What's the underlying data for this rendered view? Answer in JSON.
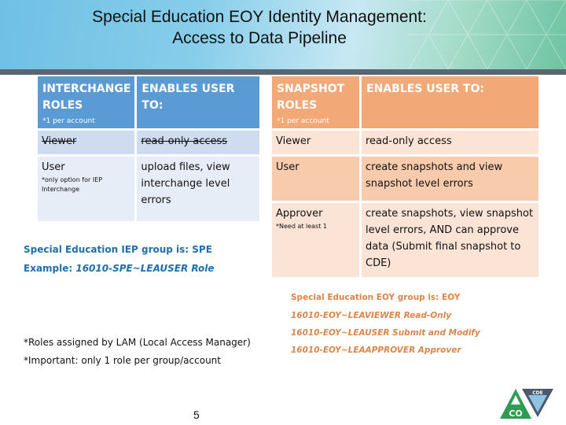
{
  "header": {
    "title_line1": "Special Education EOY Identity Management:",
    "title_line2": "Access to Data Pipeline"
  },
  "interchange_table": {
    "headers": {
      "role": "INTERCHANGE ROLES",
      "role_note": "*1 per account",
      "enables": "ENABLES USER TO:"
    },
    "rows": [
      {
        "role": "Viewer",
        "note": "",
        "enables": "read-only access",
        "struck": true
      },
      {
        "role": "User",
        "note": "*only option for IEP Interchange",
        "enables": "upload files, view interchange level errors",
        "struck": false
      }
    ],
    "color": "#5b9bd5"
  },
  "snapshot_table": {
    "headers": {
      "role": "SNAPSHOT ROLES",
      "role_note": "*1 per account",
      "enables": "ENABLES USER TO:"
    },
    "rows": [
      {
        "role": "Viewer",
        "note": "",
        "enables": "read-only access"
      },
      {
        "role": "User",
        "note": "",
        "enables": "create snapshots and view snapshot level errors"
      },
      {
        "role": "Approver",
        "note": "*Need at least 1",
        "enables": "create snapshots, view snapshot level errors, AND can approve data (Submit final snapshot to CDE)"
      }
    ],
    "color": "#f2a977"
  },
  "iep_notes": {
    "group": "Special Education IEP group is: SPE",
    "example_label": "Example: ",
    "example_value": "16010-SPE~LEAUSER Role"
  },
  "eoy_notes": {
    "group": "Special Education EOY group is: EOY",
    "roles": [
      "16010-EOY~LEAVIEWER Read-Only",
      "16010-EOY~LEAUSER Submit and Modify",
      "16010-EOY~LEAAPPROVER Approver"
    ]
  },
  "footnotes": [
    "*Roles assigned by LAM (Local Access Manager)",
    "*Important: only 1 role per group/account"
  ],
  "page_number": "5",
  "logo": {
    "left_text": "CO",
    "right_text": "CDE"
  }
}
